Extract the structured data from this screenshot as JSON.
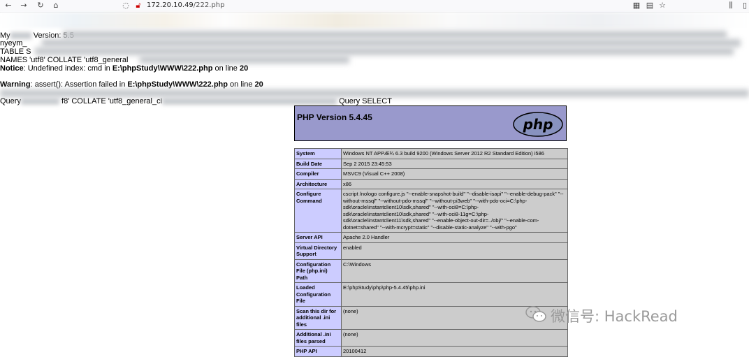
{
  "browser": {
    "back_icon": "arrow-left-icon",
    "forward_icon": "arrow-right-icon",
    "reload_icon": "reload-icon",
    "home_icon": "home-icon",
    "url_host": "172.20.10.49",
    "url_path": "/222.php"
  },
  "output": {
    "line1_start": "My",
    "line1_mid": "Version: 5.5",
    "line2_start": "nyeym_",
    "line3_start": "TABLE S",
    "line4_start": "NAMES 'utf8' COLLATE 'utf8_general",
    "notice_label": "Notice",
    "notice_text": ": Undefined index: cmd in ",
    "notice_file": "E:\\phpStudy\\WWW\\222.php",
    "notice_online": " on line ",
    "notice_line": "20",
    "warning_label": "Warning",
    "warning_text": ": assert(): Assertion failed in ",
    "warning_file": "E:\\phpStudy\\WWW\\222.php",
    "warning_online": " on line ",
    "warning_line": "20",
    "query_start": "Query",
    "query_text": "f8' COLLATE 'utf8_general_ci",
    "query_end": "Query SELECT"
  },
  "phpinfo": {
    "title": "PHP Version 5.4.45",
    "logo_text": "php",
    "rows": [
      {
        "k": "System",
        "v": "Windows NT APPÆ¾ 6.3 build 9200 (Windows Server 2012 R2 Standard Edition) i586"
      },
      {
        "k": "Build Date",
        "v": "Sep 2 2015 23:45:53"
      },
      {
        "k": "Compiler",
        "v": "MSVC9 (Visual C++ 2008)"
      },
      {
        "k": "Architecture",
        "v": "x86"
      },
      {
        "k": "Configure Command",
        "v": "cscript /nologo configure.js \"--enable-snapshot-build\" \"--disable-isapi\" \"--enable-debug-pack\" \"--without-mssql\" \"--without-pdo-mssql\" \"--without-pi3web\" \"--with-pdo-oci=C:\\php-sdk\\oracle\\instantclient10\\sdk,shared\" \"--with-oci8=C:\\php-sdk\\oracle\\instantclient10\\sdk,shared\" \"--with-oci8-11g=C:\\php-sdk\\oracle\\instantclient11\\sdk,shared\" \"--enable-object-out-dir=../obj/\" \"--enable-com-dotnet=shared\" \"--with-mcrypt=static\" \"--disable-static-analyze\" \"--with-pgo\""
      },
      {
        "k": "Server API",
        "v": "Apache 2.0 Handler"
      },
      {
        "k": "Virtual Directory Support",
        "v": "enabled"
      },
      {
        "k": "Configuration File (php.ini) Path",
        "v": "C:\\Windows"
      },
      {
        "k": "Loaded Configuration File",
        "v": "E:\\phpStudy\\php\\php-5.4.45\\php.ini"
      },
      {
        "k": "Scan this dir for additional .ini files",
        "v": "(none)"
      },
      {
        "k": "Additional .ini files parsed",
        "v": "(none)"
      },
      {
        "k": "PHP API",
        "v": "20100412"
      }
    ]
  },
  "watermark": {
    "text": "微信号: HackRead"
  },
  "colors": {
    "php_header": "#9999cc",
    "key_cell": "#ccccff",
    "value_cell": "#cccccc"
  }
}
